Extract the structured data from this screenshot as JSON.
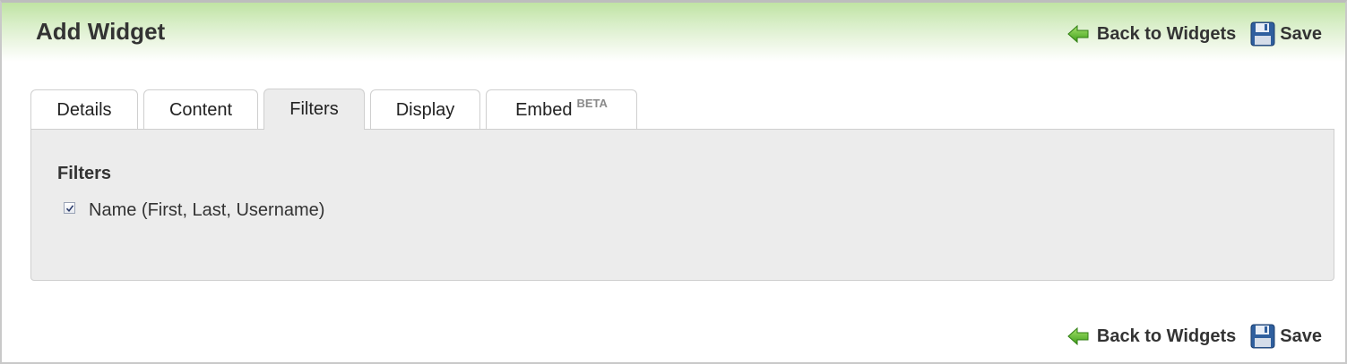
{
  "header": {
    "title": "Add Widget",
    "back_label": "Back to Widgets",
    "save_label": "Save"
  },
  "tabs": [
    {
      "label": "Details",
      "active": false
    },
    {
      "label": "Content",
      "active": false
    },
    {
      "label": "Filters",
      "active": true
    },
    {
      "label": "Display",
      "active": false
    },
    {
      "label": "Embed",
      "badge": "BETA",
      "active": false
    }
  ],
  "panel": {
    "title": "Filters",
    "filters": [
      {
        "label": "Name (First, Last, Username)",
        "checked": true
      }
    ]
  },
  "footer": {
    "back_label": "Back to Widgets",
    "save_label": "Save"
  },
  "icons": {
    "back": "green-arrow-left-icon",
    "save": "floppy-disk-icon"
  },
  "colors": {
    "header_gradient_top": "#bfe3a3",
    "panel_background": "#ececec",
    "arrow_green": "#5cbf2a",
    "floppy_blue": "#2f5f9e"
  }
}
